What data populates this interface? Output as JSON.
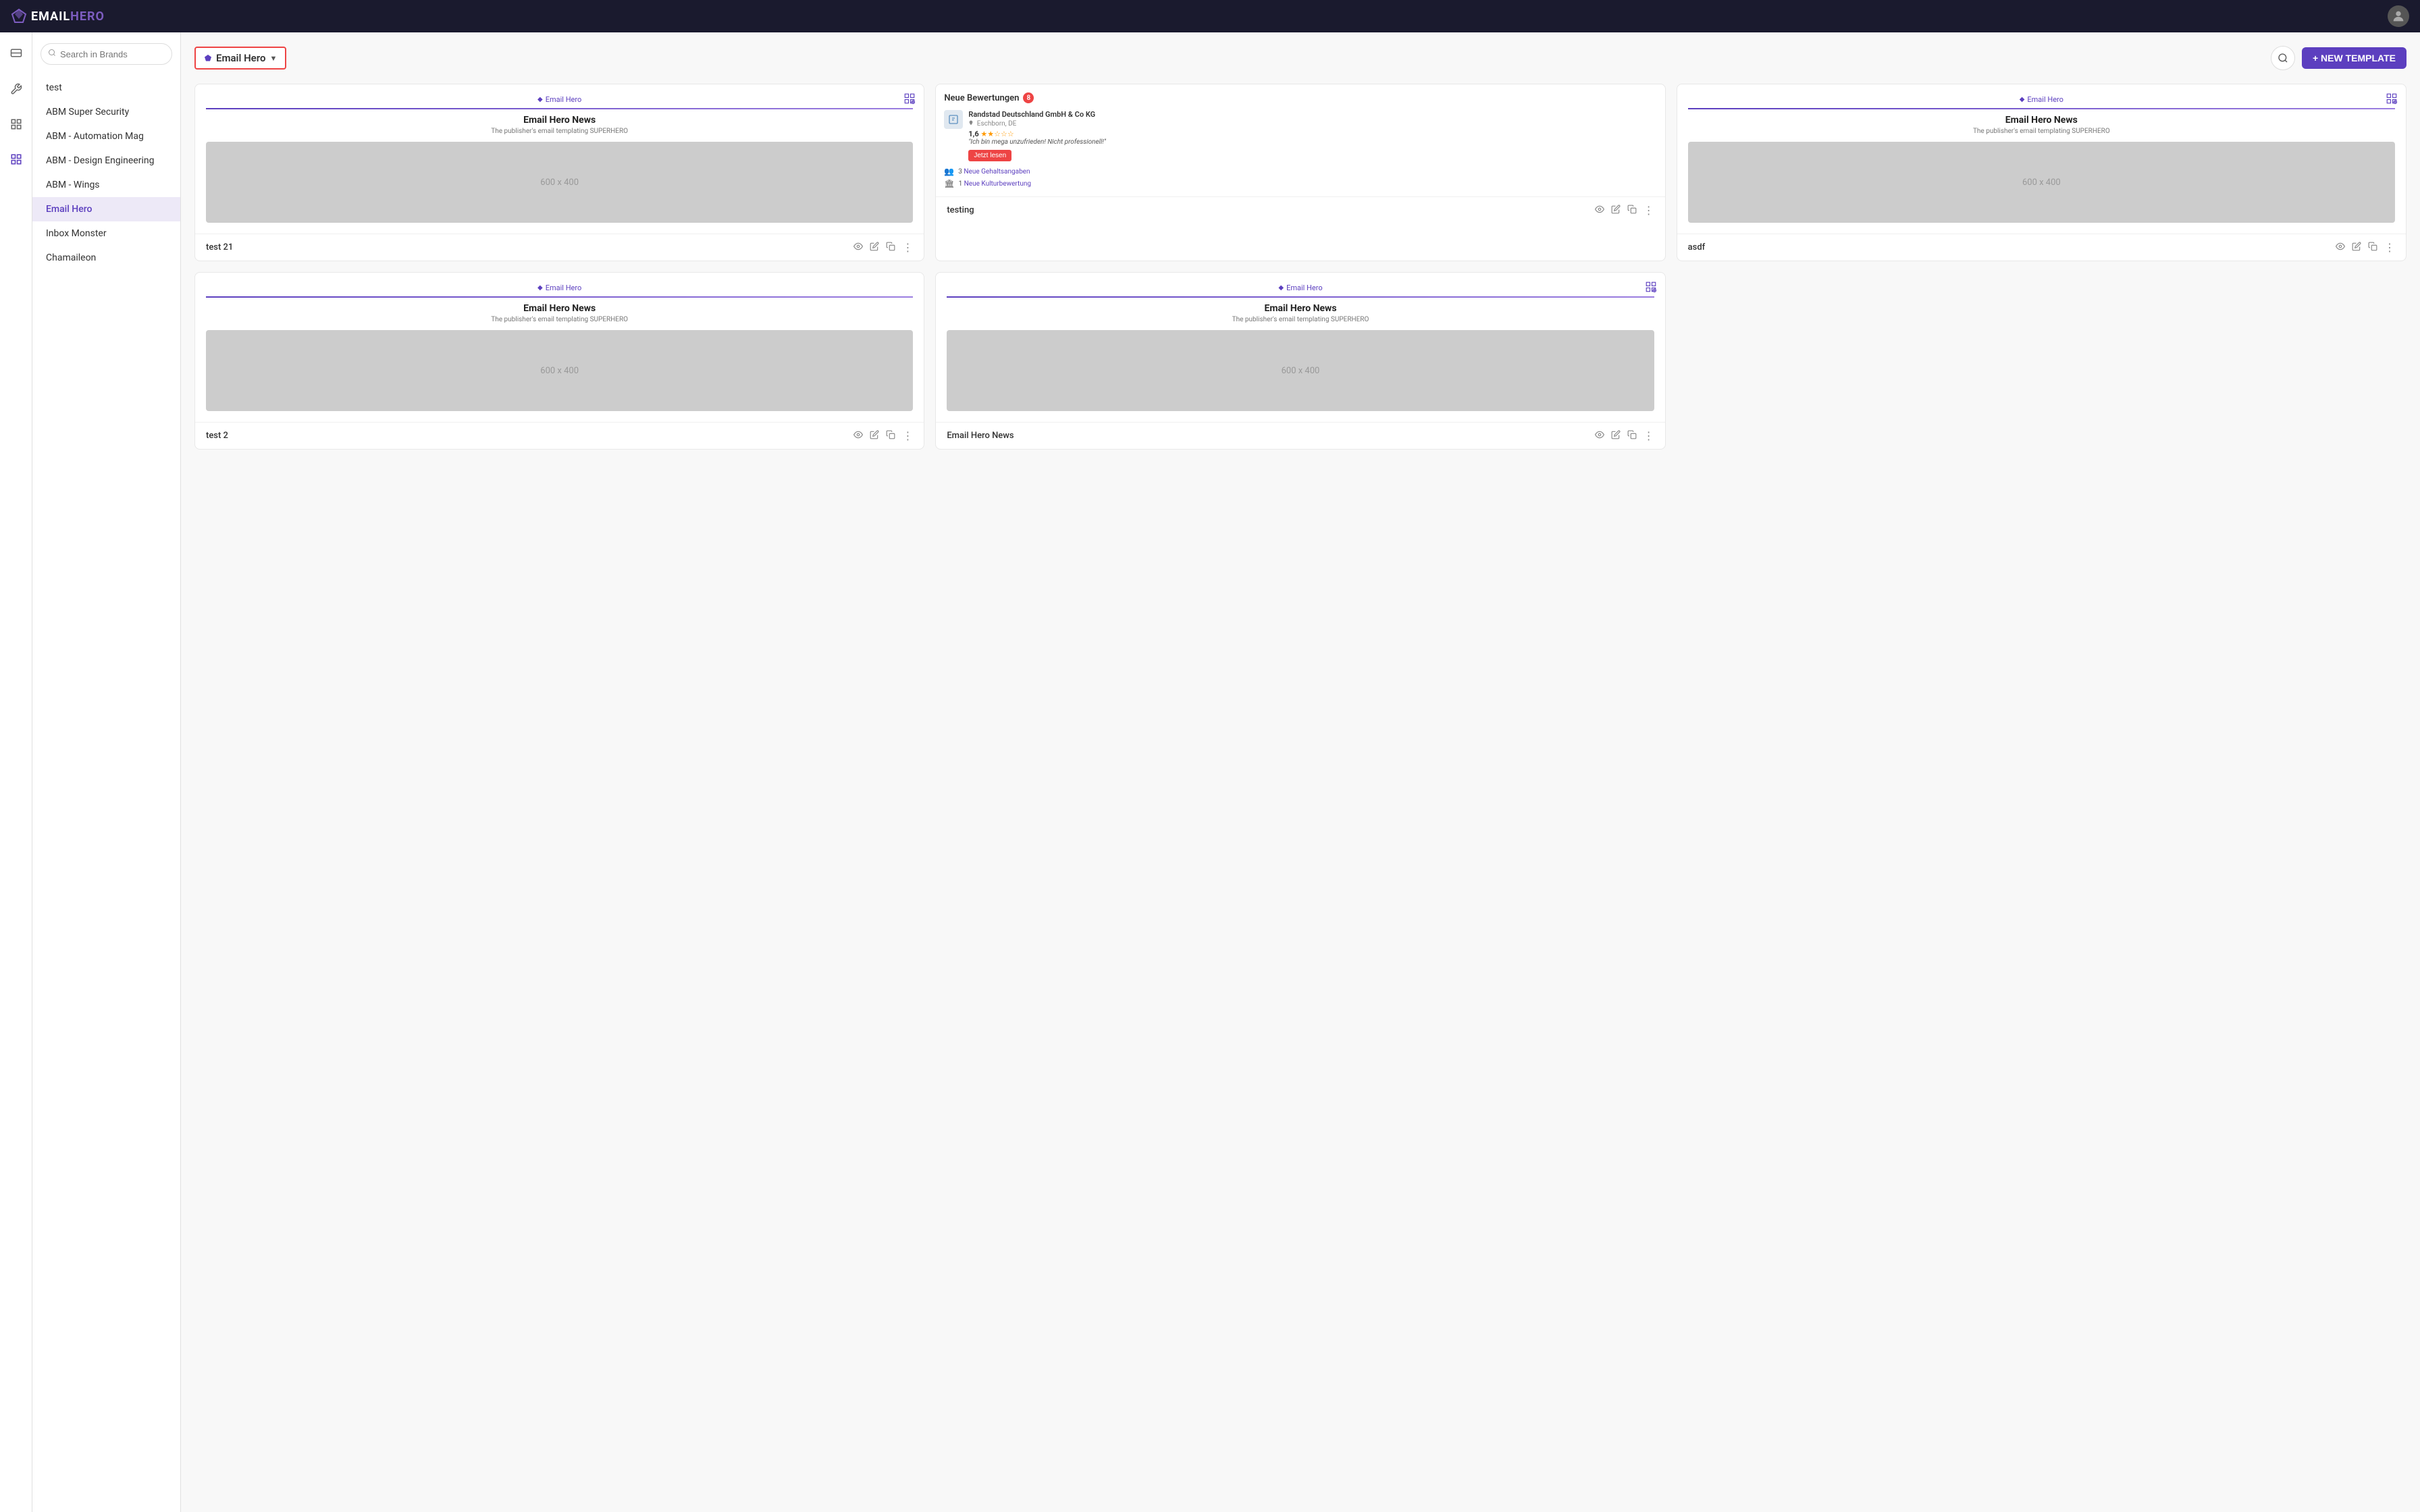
{
  "app": {
    "title": "EMAILHERO",
    "logo_text_email": "EMAIL",
    "logo_text_hero": "HERO"
  },
  "topnav": {
    "user_icon": "account-circle"
  },
  "sidebar": {
    "search_placeholder": "Search in Brands",
    "add_button_label": "+",
    "brands": [
      {
        "id": "test",
        "label": "test",
        "active": false
      },
      {
        "id": "abm-super-security",
        "label": "ABM Super Security",
        "active": false
      },
      {
        "id": "abm-automation-mag",
        "label": "ABM - Automation Mag",
        "active": false
      },
      {
        "id": "abm-design-engineering",
        "label": "ABM - Design Engineering",
        "active": false
      },
      {
        "id": "abm-wings",
        "label": "ABM - Wings",
        "active": false
      },
      {
        "id": "email-hero",
        "label": "Email Hero",
        "active": true
      },
      {
        "id": "inbox-monster",
        "label": "Inbox Monster",
        "active": false
      },
      {
        "id": "chamaileon",
        "label": "Chamaileon",
        "active": false
      }
    ]
  },
  "content": {
    "selected_brand": "Email Hero",
    "new_template_label": "+ NEW TEMPLATE",
    "cards": [
      {
        "id": "card-1",
        "brand_tag": "Email Hero",
        "title": "Email Hero News",
        "subtitle": "The publisher's email templating SUPERHERO",
        "image_label": "600 x 400",
        "name": "test 21",
        "has_grid_icon": true,
        "type": "standard"
      },
      {
        "id": "card-2",
        "brand_tag": null,
        "title": null,
        "subtitle": null,
        "image_label": null,
        "name": "testing",
        "has_grid_icon": false,
        "type": "notification",
        "notification": {
          "title": "Neue Bewertungen",
          "badge_count": "8",
          "company_name": "Randstad Deutschland GmbH & Co KG",
          "company_location": "Eschborn, DE",
          "rating": "1,6",
          "stars": "★★☆☆☆",
          "quote": "\"Ich bin mega unzufrieden! Nicht professionell!\"",
          "read_btn": "Jetzt lesen",
          "stats": [
            {
              "count": "3",
              "label": "Neue Gehaltsangaben"
            },
            {
              "count": "1",
              "label": "Neue Kulturbewertung"
            }
          ]
        }
      },
      {
        "id": "card-3",
        "brand_tag": "Email Hero",
        "title": "Email Hero News",
        "subtitle": "The publisher's email templating SUPERHERO",
        "image_label": "600 x 400",
        "name": "asdf",
        "has_grid_icon": true,
        "type": "standard"
      },
      {
        "id": "card-4",
        "brand_tag": "Email Hero",
        "title": "Email Hero News",
        "subtitle": "The publisher's email templating SUPERHERO",
        "image_label": "600 x 400",
        "name": "test 2",
        "has_grid_icon": false,
        "type": "standard"
      },
      {
        "id": "card-5",
        "brand_tag": "Email Hero",
        "title": "Email Hero News",
        "subtitle": "The publisher's email templating SUPERHERO",
        "image_label": "600 x 400",
        "name": "Email Hero News",
        "has_grid_icon": true,
        "type": "standard"
      }
    ]
  },
  "icons": {
    "search": "🔍",
    "eye": "👁",
    "edit": "✏️",
    "copy": "⬜",
    "more": "⋮",
    "grid": "⊞",
    "diamond": "◆",
    "people": "👥",
    "culture": "🏛"
  }
}
